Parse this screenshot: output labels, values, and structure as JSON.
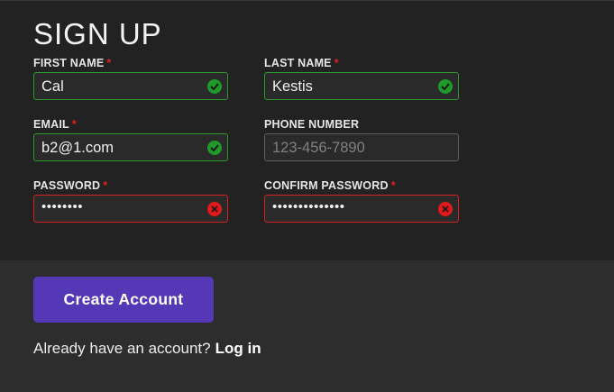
{
  "form": {
    "title": "SIGN UP",
    "required_marker": "*",
    "fields": {
      "first_name": {
        "label": "FIRST NAME",
        "required": true,
        "value": "Cal",
        "status": "valid"
      },
      "last_name": {
        "label": "LAST NAME",
        "required": true,
        "value": "Kestis",
        "status": "valid"
      },
      "email": {
        "label": "EMAIL",
        "required": true,
        "value": "b2@1.com",
        "status": "valid"
      },
      "phone": {
        "label": "PHONE NUMBER",
        "required": false,
        "value": "",
        "placeholder": "123-456-7890",
        "status": "neutral"
      },
      "password": {
        "label": "PASSWORD",
        "required": true,
        "value": "••••••••",
        "status": "invalid"
      },
      "confirm_password": {
        "label": "CONFIRM PASSWORD",
        "required": true,
        "value": "••••••••••••••",
        "status": "invalid"
      }
    }
  },
  "actions": {
    "submit_label": "Create Account",
    "login_prompt": "Already have an account?",
    "login_link": "Log in"
  },
  "icons": {
    "valid": "check-circle-icon",
    "invalid": "x-circle-icon"
  },
  "colors": {
    "panel_bg": "#222222",
    "page_bg": "#2d2d2d",
    "accent": "#5538b6",
    "valid": "#2e9a2e",
    "invalid": "#e11919",
    "required": "#e02020"
  }
}
